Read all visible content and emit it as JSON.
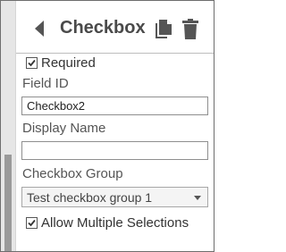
{
  "header": {
    "title": "Checkbox",
    "back_icon": "back-arrow-icon",
    "copy_icon": "copy-icon",
    "delete_icon": "trash-icon"
  },
  "form": {
    "required": {
      "label": "Required",
      "checked": true
    },
    "field_id": {
      "label": "Field ID",
      "value": "Checkbox2"
    },
    "display_name": {
      "label": "Display Name",
      "value": ""
    },
    "checkbox_group": {
      "label": "Checkbox Group",
      "selected": "Test checkbox group 1"
    },
    "allow_multiple": {
      "label": "Allow Multiple Selections",
      "checked": true
    }
  },
  "colors": {
    "icon": "#555555",
    "border": "#6e6e6e",
    "divider": "#bdbdbd"
  }
}
